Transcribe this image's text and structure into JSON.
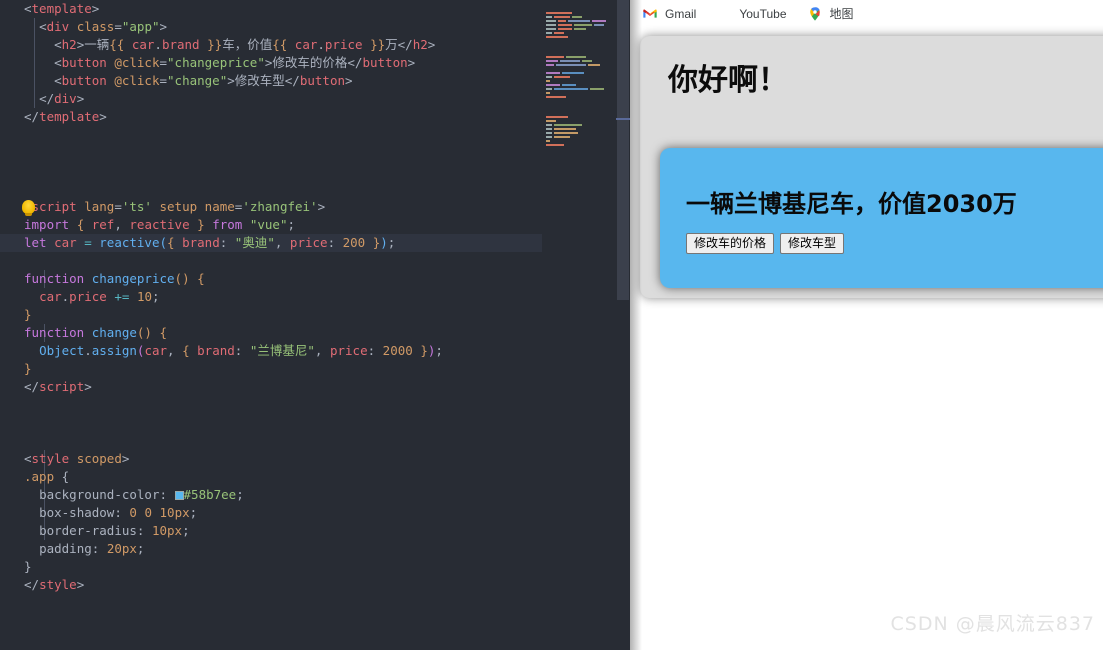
{
  "editor": {
    "language": "vue",
    "theme_bg": "#282c34",
    "current_line_index": 12,
    "lightbulb_hint": "quick-fix-lightbulb",
    "color_swatch": "#58b7ee",
    "code_lines": [
      "<template>",
      "  <div class=\"app\">",
      "    <h2>一辆{{ car.brand }}车，价值{{ car.price }}万</h2>",
      "    <button @click=\"changeprice\">修改车的价格</button>",
      "    <button @click=\"change\">修改车型</button>",
      "  </div>",
      "</template>",
      "",
      "",
      "",
      "<script lang='ts' setup name='zhangfei'>",
      "import { ref, reactive } from \"vue\";",
      "let car = reactive({ brand: \"奥迪\", price: 200 });",
      "",
      "function changeprice() {",
      "  car.price += 10;",
      "}",
      "function change() {",
      "  Object.assign(car, { brand: \"兰博基尼\", price: 2000 });",
      "}",
      "</script>",
      "",
      "",
      "",
      "<style scoped>",
      ".app {",
      "  background-color: #58b7ee;",
      "  box-shadow: 0 0 10px;",
      "  border-radius: 10px;",
      "  padding: 20px;",
      "}",
      "</style>"
    ]
  },
  "browser": {
    "bookmarks": [
      {
        "label": "Gmail",
        "icon": "gmail-icon"
      },
      {
        "label": "YouTube",
        "icon": "youtube-icon"
      },
      {
        "label": "地图",
        "icon": "google-maps-icon"
      }
    ]
  },
  "preview": {
    "greeting": "你好啊！",
    "card": {
      "background_color": "#58b7ee",
      "heading": "一辆兰博基尼车，价值2030万",
      "buttons": [
        {
          "label": "修改车的价格"
        },
        {
          "label": "修改车型"
        }
      ]
    }
  },
  "watermark": {
    "text": "CSDN @晨风流云837"
  }
}
